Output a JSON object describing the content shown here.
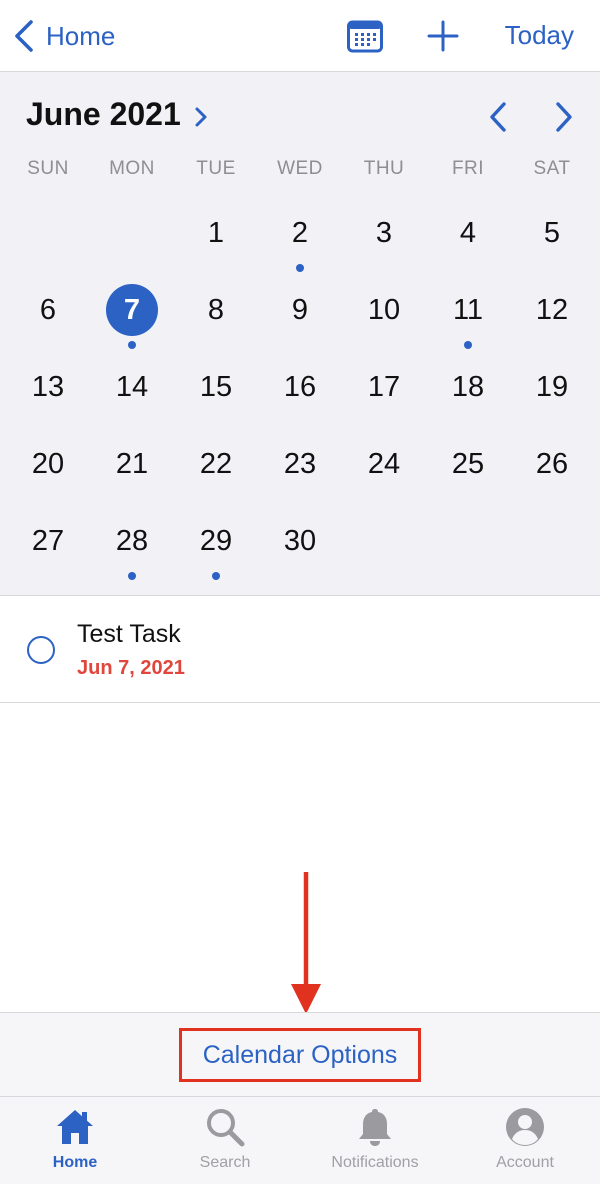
{
  "nav": {
    "back_label": "Home",
    "today_label": "Today"
  },
  "calendar": {
    "month_label": "June 2021",
    "weekdays": [
      "SUN",
      "MON",
      "TUE",
      "WED",
      "THU",
      "FRI",
      "SAT"
    ],
    "weeks": [
      [
        null,
        null,
        1,
        2,
        3,
        4,
        5
      ],
      [
        6,
        7,
        8,
        9,
        10,
        11,
        12
      ],
      [
        13,
        14,
        15,
        16,
        17,
        18,
        19
      ],
      [
        20,
        21,
        22,
        23,
        24,
        25,
        26
      ],
      [
        27,
        28,
        29,
        30,
        null,
        null,
        null
      ]
    ],
    "selected_day": 7,
    "days_with_dots": [
      2,
      7,
      11,
      28,
      29
    ]
  },
  "task": {
    "title": "Test Task",
    "date": "Jun 7, 2021"
  },
  "options": {
    "label": "Calendar Options"
  },
  "tabs": [
    {
      "label": "Home",
      "icon": "house-icon",
      "active": true
    },
    {
      "label": "Search",
      "icon": "search-icon",
      "active": false
    },
    {
      "label": "Notifications",
      "icon": "bell-icon",
      "active": false
    },
    {
      "label": "Account",
      "icon": "person-icon",
      "active": false
    }
  ],
  "colors": {
    "accent": "#2b62c4",
    "due_date": "#e0463c",
    "annotation": "#e0321e"
  }
}
